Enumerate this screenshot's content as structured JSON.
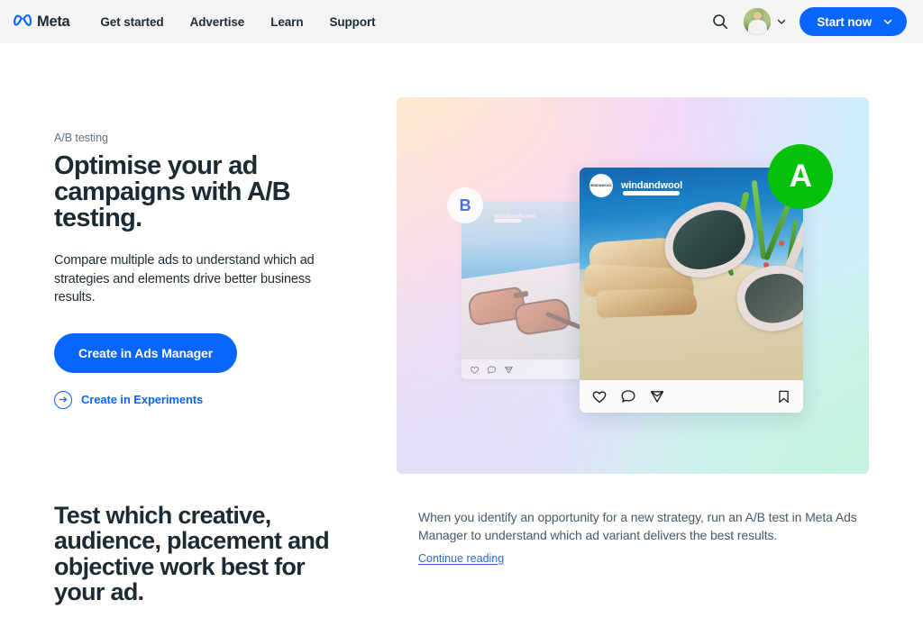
{
  "header": {
    "brand": "Meta",
    "brand_logo_color": "#0866ff",
    "nav": [
      {
        "label": "Get started"
      },
      {
        "label": "Advertise"
      },
      {
        "label": "Learn"
      },
      {
        "label": "Support"
      }
    ],
    "search_icon": "search-icon",
    "avatar_chevron_icon": "chevron-down-icon",
    "cta": {
      "label": "Start now",
      "chevron_icon": "chevron-down-icon",
      "color": "#0866ff"
    }
  },
  "hero": {
    "eyebrow": "A/B testing",
    "title": "Optimise your ad campaigns with A/B testing.",
    "subtitle": "Compare multiple ads to understand which ad strategies and elements drive better business results.",
    "primary_cta": "Create in Ads Manager",
    "secondary_cta": "Create in Experiments",
    "secondary_cta_icon": "arrow-right-circle-icon",
    "accent_color": "#0866ff"
  },
  "hero_visual": {
    "badge_a": {
      "letter": "A",
      "color": "#05c10a",
      "text_color": "#ffffff"
    },
    "badge_b": {
      "letter": "B",
      "color": "#ffffff",
      "text_color": "#4f6fdd"
    },
    "card_a": {
      "username": "windandwool",
      "avatar_text": "WIND&WOOL",
      "actions": [
        "heart-icon",
        "comment-icon",
        "share-icon",
        "bookmark-icon"
      ]
    },
    "card_b": {
      "username": "windandwool",
      "actions": [
        "heart-icon",
        "comment-icon",
        "share-icon"
      ]
    }
  },
  "lower": {
    "title": "Test which creative, audience, placement and objective work best for your ad.",
    "body": "When you identify an opportunity for a new strategy, run an A/B test in Meta Ads Manager to understand which ad variant delivers the best results.",
    "continue_link": "Continue reading"
  }
}
